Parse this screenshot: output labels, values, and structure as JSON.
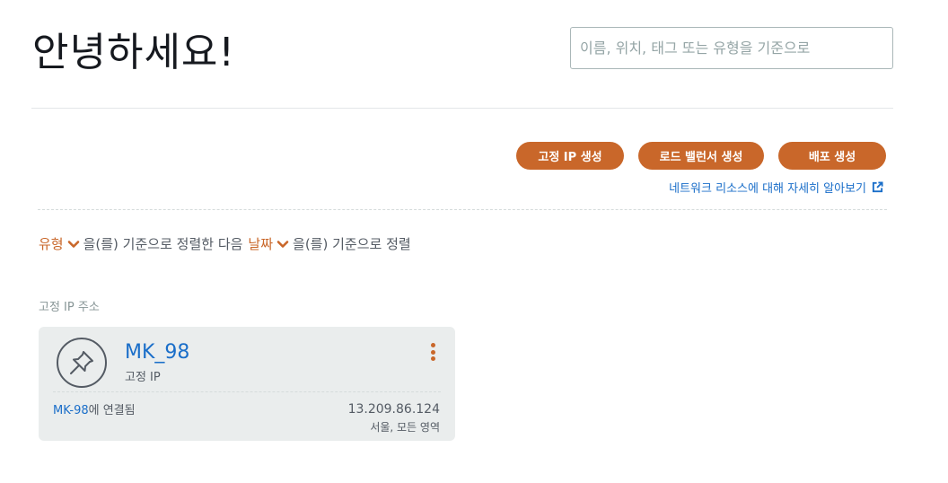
{
  "header": {
    "greeting": "안녕하세요!",
    "search_placeholder": "이름, 위치, 태그 또는 유형을 기준으로"
  },
  "actions": {
    "create_static_ip": "고정 IP 생성",
    "create_load_balancer": "로드 밸런서 생성",
    "create_distribution": "배포 생성",
    "learn_more": "네트워크 리소스에 대해 자세히 알아보기"
  },
  "sort": {
    "key1": "유형",
    "text1": "을(를) 기준으로 정렬한 다음",
    "key2": "날짜",
    "text2": "을(를) 기준으로 정렬"
  },
  "section": {
    "label": "고정 IP 주소"
  },
  "card": {
    "name": "MK_98",
    "type": "고정 IP",
    "attached_instance": "MK-98",
    "attached_suffix": "에 연결됨",
    "ip_address": "13.209.86.124",
    "region": "서울, 모든 영역",
    "icon": "pin-icon"
  },
  "colors": {
    "accent": "#c9672a",
    "link": "#1a6ec9",
    "card_bg": "#eaeded"
  }
}
